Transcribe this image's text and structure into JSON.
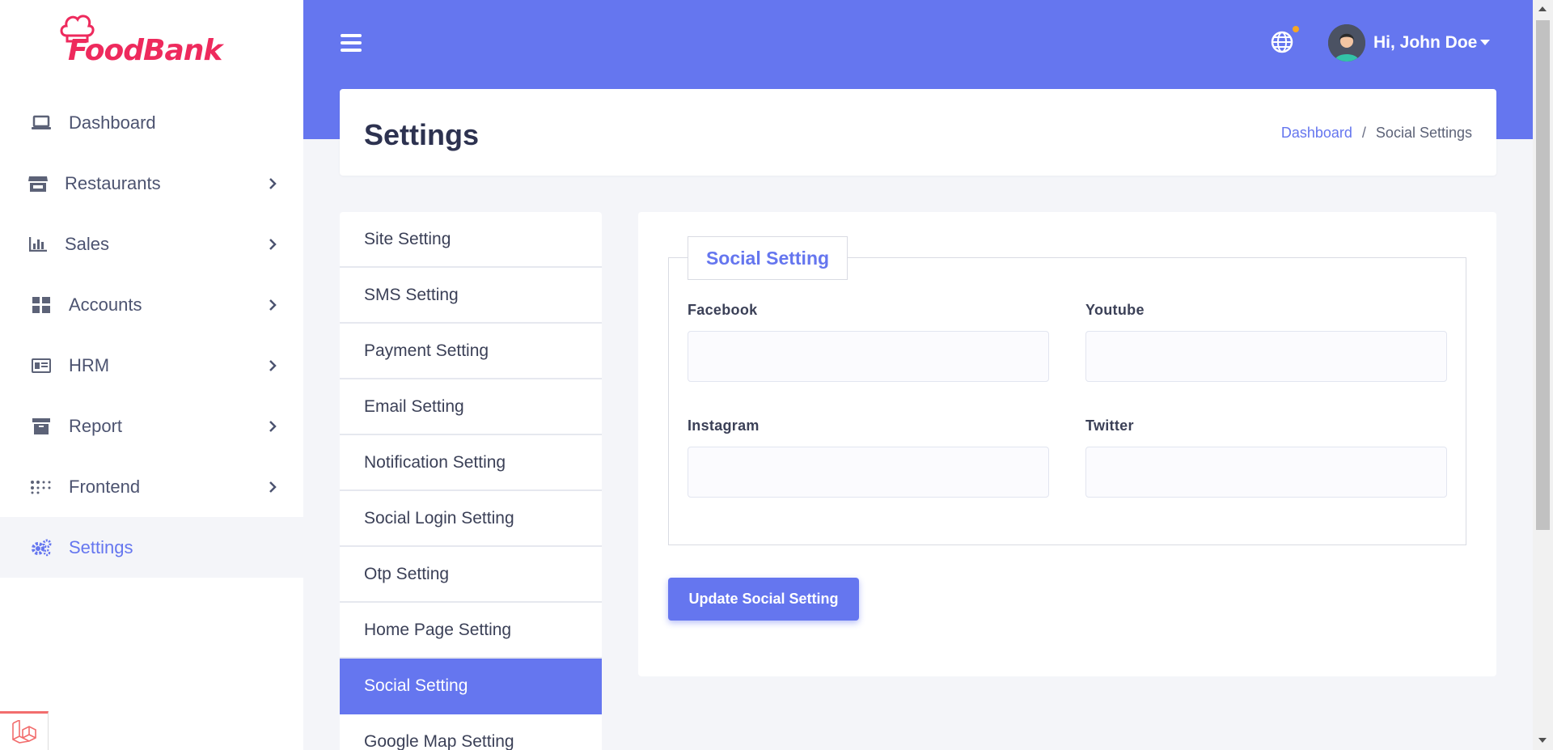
{
  "brand": {
    "name": "FoodBank",
    "color": "#ee2a5d"
  },
  "colors": {
    "accent": "#6576ef",
    "notification_dot": "#f6a623"
  },
  "sidebar": {
    "items": [
      {
        "label": "Dashboard",
        "icon": "laptop-icon",
        "has_submenu": false
      },
      {
        "label": "Restaurants",
        "icon": "store-icon",
        "has_submenu": true
      },
      {
        "label": "Sales",
        "icon": "bar-chart-icon",
        "has_submenu": true
      },
      {
        "label": "Accounts",
        "icon": "grid-icon",
        "has_submenu": true
      },
      {
        "label": "HRM",
        "icon": "id-card-icon",
        "has_submenu": true
      },
      {
        "label": "Report",
        "icon": "archive-icon",
        "has_submenu": true
      },
      {
        "label": "Frontend",
        "icon": "dots-grid-icon",
        "has_submenu": true
      },
      {
        "label": "Settings",
        "icon": "gears-icon",
        "has_submenu": false,
        "active": true
      }
    ]
  },
  "topbar": {
    "user_greeting": "Hi, John Doe",
    "menu_icon": "hamburger-icon",
    "language_icon": "globe-icon"
  },
  "header": {
    "title": "Settings",
    "breadcrumb": {
      "link": "Dashboard",
      "separator": "/",
      "current": "Social Settings"
    }
  },
  "settings_menu": {
    "items": [
      "Site Setting",
      "SMS Setting",
      "Payment Setting",
      "Email Setting",
      "Notification Setting",
      "Social Login Setting",
      "Otp Setting",
      "Home Page Setting",
      "Social Setting",
      "Google Map Setting"
    ],
    "active_index": 8
  },
  "form": {
    "legend": "Social Setting",
    "fields": {
      "facebook": {
        "label": "Facebook",
        "value": ""
      },
      "youtube": {
        "label": "Youtube",
        "value": ""
      },
      "instagram": {
        "label": "Instagram",
        "value": ""
      },
      "twitter": {
        "label": "Twitter",
        "value": ""
      }
    },
    "submit_label": "Update Social Setting"
  }
}
